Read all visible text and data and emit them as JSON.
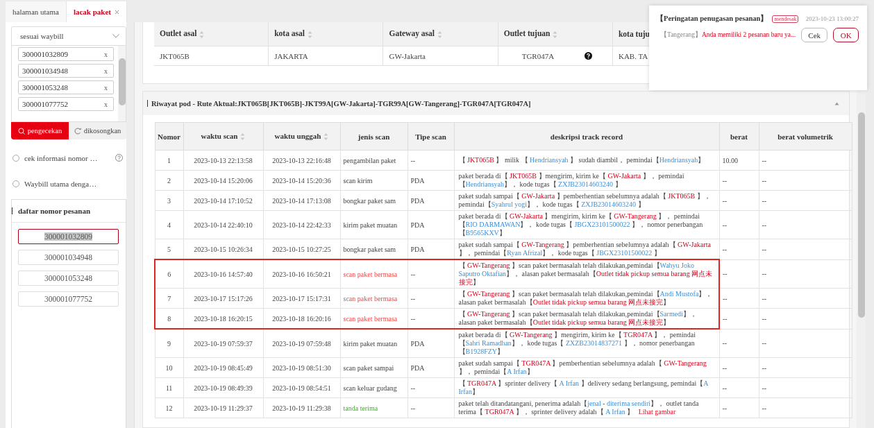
{
  "tabs": [
    {
      "label": "halaman utama",
      "selected": false,
      "closable": false
    },
    {
      "label": "lacak paket",
      "selected": true,
      "closable": true
    }
  ],
  "search_panel": {
    "mode_select": "sesuai waybill",
    "waybills": [
      {
        "number": "300001032809",
        "remove": "x"
      },
      {
        "number": "300001034948",
        "remove": "x"
      },
      {
        "number": "300001053248",
        "remove": "x"
      },
      {
        "number": "300001077752",
        "remove": "x"
      }
    ],
    "buttons": [
      {
        "label": "pengecekan",
        "kind": "primary"
      },
      {
        "label": "dikosongkan",
        "kind": "reset"
      }
    ],
    "options": [
      {
        "label": "cek informasi nomor …",
        "selected": false,
        "help": true
      },
      {
        "label": "Waybill utama denga…",
        "selected": false,
        "help": false
      }
    ]
  },
  "order_list": {
    "title": "daftar nomor pesanan",
    "items": [
      {
        "number": "300001032809",
        "selected": true
      },
      {
        "number": "300001034948",
        "selected": false
      },
      {
        "number": "300001053248",
        "selected": false
      },
      {
        "number": "300001077752",
        "selected": false
      }
    ]
  },
  "summary_table": {
    "columns": [
      {
        "label": "Outlet asal",
        "sortable": true
      },
      {
        "label": "kota asal",
        "sortable": true
      },
      {
        "label": "Gateway asal",
        "sortable": true
      },
      {
        "label": "Outlet tujuan",
        "sortable": true
      },
      {
        "label": "kota tuju",
        "sortable": false
      }
    ],
    "rows": [
      {
        "cells": [
          {
            "text": "JKT065B",
            "help": false
          },
          {
            "text": "JAKARTA",
            "help": false
          },
          {
            "text": "GW-Jakarta",
            "help": false
          },
          {
            "text": "TGR047A",
            "help": true
          },
          {
            "text": "KAB. TA",
            "help": false
          }
        ]
      }
    ]
  },
  "history": {
    "title": "Riwayat pod - Rute Aktual:JKT065B[JKT065B]-JKT99A[GW-Jakarta]-TGR99A[GW-Tangerang]-TGR047A[TGR047A]",
    "expanded": true,
    "columns": [
      {
        "label": "Nomor",
        "sortable": false
      },
      {
        "label": "waktu scan",
        "sortable": true
      },
      {
        "label": "waktu unggah",
        "sortable": true
      },
      {
        "label": "jenis scan",
        "sortable": false
      },
      {
        "label": "Tipe scan",
        "sortable": false
      },
      {
        "label": "deskripsi track record",
        "sortable": false
      },
      {
        "label": "berat",
        "sortable": false
      },
      {
        "label": "berat volumetrik",
        "sortable": false
      }
    ],
    "rows": [
      {
        "no": "1",
        "scan_time": "2023-10-13 22:13:58",
        "upload_time": "2023-10-13 22:16:48",
        "scan_type": "pengambilan paket",
        "problem": false,
        "signed": false,
        "device": "--",
        "flagged": false,
        "weight": "10.00",
        "volume": "--",
        "description": [
          {
            "kind": "plain",
            "text": "【 "
          },
          {
            "kind": "code",
            "text": "JKT065B"
          },
          {
            "kind": "plain",
            "text": " 】 milik 【 "
          },
          {
            "kind": "person",
            "text": "Hendriansyah"
          },
          {
            "kind": "plain",
            "text": " 】 sudah diambil， pemindai【"
          },
          {
            "kind": "person",
            "text": "Hendriansyah"
          },
          {
            "kind": "plain",
            "text": "】"
          }
        ]
      },
      {
        "no": "2",
        "scan_time": "2023-10-14 15:20:06",
        "upload_time": "2023-10-14 15:20:36",
        "scan_type": "scan kirim",
        "problem": false,
        "signed": false,
        "device": "PDA",
        "flagged": false,
        "weight": "--",
        "volume": "--",
        "description": [
          {
            "kind": "plain",
            "text": "paket berada di【 "
          },
          {
            "kind": "code",
            "text": "JKT065B"
          },
          {
            "kind": "plain",
            "text": " 】mengirim, kirim ke【 "
          },
          {
            "kind": "code",
            "text": "GW-Jakarta"
          },
          {
            "kind": "plain",
            "text": " 】， pemindai【"
          },
          {
            "kind": "person",
            "text": "Hendriansyah"
          },
          {
            "kind": "plain",
            "text": "】， kode tugas【 "
          },
          {
            "kind": "person",
            "text": "ZXJB23014603240"
          },
          {
            "kind": "plain",
            "text": " 】"
          }
        ]
      },
      {
        "no": "3",
        "scan_time": "2023-10-14 17:10:52",
        "upload_time": "2023-10-14 17:13:08",
        "scan_type": "bongkar paket sam",
        "problem": false,
        "signed": false,
        "device": "PDA",
        "flagged": false,
        "weight": "--",
        "volume": "--",
        "description": [
          {
            "kind": "plain",
            "text": "paket sudah sampai【 "
          },
          {
            "kind": "code",
            "text": "GW-Jakarta"
          },
          {
            "kind": "plain",
            "text": " 】pemberhentian sebelumnya adalah【 "
          },
          {
            "kind": "code",
            "text": "JKT065B"
          },
          {
            "kind": "plain",
            "text": " 】， pemindai【"
          },
          {
            "kind": "person",
            "text": "Syahrul yogi"
          },
          {
            "kind": "plain",
            "text": "】， kode tugas【 "
          },
          {
            "kind": "person",
            "text": "ZXJB23014603240"
          },
          {
            "kind": "plain",
            "text": " 】"
          }
        ]
      },
      {
        "no": "4",
        "scan_time": "2023-10-14 22:40:10",
        "upload_time": "2023-10-14 22:42:33",
        "scan_type": "kirim paket muatan",
        "problem": false,
        "signed": false,
        "device": "PDA",
        "flagged": false,
        "weight": "--",
        "volume": "--",
        "description": [
          {
            "kind": "plain",
            "text": "paket berada di【 "
          },
          {
            "kind": "code",
            "text": "GW-Jakarta"
          },
          {
            "kind": "plain",
            "text": " 】mengirim, kirim ke【 "
          },
          {
            "kind": "code",
            "text": "GW-Tangerang"
          },
          {
            "kind": "plain",
            "text": " 】， pemindai【"
          },
          {
            "kind": "person",
            "text": "RIO DARMAWAN"
          },
          {
            "kind": "plain",
            "text": "】， kode tugas【 "
          },
          {
            "kind": "person",
            "text": "JBGX23101500022"
          },
          {
            "kind": "plain",
            "text": " 】， nomor penerbangan【"
          },
          {
            "kind": "person",
            "text": "B9565KXV"
          },
          {
            "kind": "plain",
            "text": "】"
          }
        ]
      },
      {
        "no": "5",
        "scan_time": "2023-10-15 10:26:34",
        "upload_time": "2023-10-15 10:27:25",
        "scan_type": "bongkar paket sam",
        "problem": false,
        "signed": false,
        "device": "PDA",
        "flagged": false,
        "weight": "--",
        "volume": "--",
        "description": [
          {
            "kind": "plain",
            "text": "paket sudah sampai【 "
          },
          {
            "kind": "code",
            "text": "GW-Tangerang"
          },
          {
            "kind": "plain",
            "text": " 】pemberhentian sebelumnya adalah【 "
          },
          {
            "kind": "code",
            "text": "GW-Jakarta"
          },
          {
            "kind": "plain",
            "text": " 】， pemindai【"
          },
          {
            "kind": "person",
            "text": "Ryan Afrizal"
          },
          {
            "kind": "plain",
            "text": "】， kode tugas【 "
          },
          {
            "kind": "person",
            "text": "JBGX23101500022"
          },
          {
            "kind": "plain",
            "text": " 】"
          }
        ]
      },
      {
        "no": "6",
        "scan_time": "2023-10-16 14:57:40",
        "upload_time": "2023-10-16 16:50:21",
        "scan_type": "scan paket bermasa",
        "problem": true,
        "signed": false,
        "device": "--",
        "flagged": true,
        "weight": "--",
        "volume": "--",
        "description": [
          {
            "kind": "plain",
            "text": "【 "
          },
          {
            "kind": "code",
            "text": "GW-Tangerang"
          },
          {
            "kind": "plain",
            "text": " 】scan paket bermasalah telah dilakukan,pemindai【"
          },
          {
            "kind": "person",
            "text": "Wahyu Joko Saputro Oktafian"
          },
          {
            "kind": "plain",
            "text": "】， alasan paket bermasalah【"
          },
          {
            "kind": "code",
            "text": "Outlet tidak pickup semua barang 网点未接完"
          },
          {
            "kind": "plain",
            "text": "】"
          }
        ]
      },
      {
        "no": "7",
        "scan_time": "2023-10-17 15:17:26",
        "upload_time": "2023-10-17 15:17:31",
        "scan_type": "scan paket bermasa",
        "problem": true,
        "signed": false,
        "device": "--",
        "flagged": true,
        "weight": "--",
        "volume": "--",
        "description": [
          {
            "kind": "plain",
            "text": "【 "
          },
          {
            "kind": "code",
            "text": "GW-Tangerang"
          },
          {
            "kind": "plain",
            "text": " 】scan paket bermasalah telah dilakukan,pemindai【"
          },
          {
            "kind": "person",
            "text": "Andi Mustofa"
          },
          {
            "kind": "plain",
            "text": "】， alasan paket bermasalah【"
          },
          {
            "kind": "code",
            "text": "Outlet tidak pickup semua barang 网点未接完"
          },
          {
            "kind": "plain",
            "text": "】"
          }
        ]
      },
      {
        "no": "8",
        "scan_time": "2023-10-18 16:20:15",
        "upload_time": "2023-10-18 16:20:16",
        "scan_type": "scan paket bermasa",
        "problem": true,
        "signed": false,
        "device": "--",
        "flagged": true,
        "weight": "--",
        "volume": "--",
        "description": [
          {
            "kind": "plain",
            "text": "【 "
          },
          {
            "kind": "code",
            "text": "GW-Tangerang"
          },
          {
            "kind": "plain",
            "text": " 】scan paket bermasalah telah dilakukan,pemindai【"
          },
          {
            "kind": "person",
            "text": "Sarmedi"
          },
          {
            "kind": "plain",
            "text": "】， alasan paket bermasalah【"
          },
          {
            "kind": "code",
            "text": "Outlet tidak pickup semua barang 网点未接完"
          },
          {
            "kind": "plain",
            "text": "】"
          }
        ]
      },
      {
        "no": "9",
        "scan_time": "2023-10-19 07:59:37",
        "upload_time": "2023-10-19 07:59:48",
        "scan_type": "kirim paket muatan",
        "problem": false,
        "signed": false,
        "device": "PDA",
        "flagged": false,
        "weight": "--",
        "volume": "--",
        "description": [
          {
            "kind": "plain",
            "text": "paket berada di【 "
          },
          {
            "kind": "code",
            "text": "GW-Tangerang"
          },
          {
            "kind": "plain",
            "text": " 】mengirim, kirim ke【 "
          },
          {
            "kind": "code",
            "text": "TGR047A"
          },
          {
            "kind": "plain",
            "text": " 】， pemindai【"
          },
          {
            "kind": "person",
            "text": "Sahri Ramadhan"
          },
          {
            "kind": "plain",
            "text": "】， kode tugas【 "
          },
          {
            "kind": "person",
            "text": "ZXZB23014837271"
          },
          {
            "kind": "plain",
            "text": " 】， nomor penerbangan【"
          },
          {
            "kind": "person",
            "text": "B1928FZY"
          },
          {
            "kind": "plain",
            "text": "】"
          }
        ]
      },
      {
        "no": "10",
        "scan_time": "2023-10-19 08:45:49",
        "upload_time": "2023-10-19 08:51:30",
        "scan_type": "scan paket sampai",
        "problem": false,
        "signed": false,
        "device": "PDA",
        "flagged": false,
        "weight": "--",
        "volume": "--",
        "description": [
          {
            "kind": "plain",
            "text": "paket sudah sampai【 "
          },
          {
            "kind": "code",
            "text": "TGR047A"
          },
          {
            "kind": "plain",
            "text": " 】pemberhentian sebelumnya adalah【 "
          },
          {
            "kind": "code",
            "text": "GW-Tangerang"
          },
          {
            "kind": "plain",
            "text": " 】， pemindai【"
          },
          {
            "kind": "person",
            "text": "A Irfan"
          },
          {
            "kind": "plain",
            "text": "】"
          }
        ]
      },
      {
        "no": "11",
        "scan_time": "2023-10-19 08:49:39",
        "upload_time": "2023-10-19 08:54:51",
        "scan_type": "scan keluar gudang",
        "problem": false,
        "signed": false,
        "device": "--",
        "flagged": false,
        "weight": "--",
        "volume": "--",
        "description": [
          {
            "kind": "plain",
            "text": "【 "
          },
          {
            "kind": "code",
            "text": "TGR047A"
          },
          {
            "kind": "plain",
            "text": " 】sprinter delivery【 "
          },
          {
            "kind": "person",
            "text": "A Irfan"
          },
          {
            "kind": "plain",
            "text": " 】delivery sedang berlangsung, pemindai【"
          },
          {
            "kind": "person",
            "text": "A Irfan"
          },
          {
            "kind": "plain",
            "text": "】"
          }
        ]
      },
      {
        "no": "12",
        "scan_time": "2023-10-19 11:29:37",
        "upload_time": "2023-10-19 11:29:38",
        "scan_type": "tanda terima",
        "problem": false,
        "signed": true,
        "device": "--",
        "flagged": false,
        "weight": "--",
        "volume": "--",
        "description": [
          {
            "kind": "plain",
            "text": "paket telah ditandatangani, penerima adalah【"
          },
          {
            "kind": "person",
            "text": "jenal"
          },
          {
            "kind": "plain",
            "text": " - "
          },
          {
            "kind": "person",
            "text": "diterima sendiri"
          },
          {
            "kind": "plain",
            "text": "】， outlet tanda terima【 "
          },
          {
            "kind": "code",
            "text": "TGR047A"
          },
          {
            "kind": "plain",
            "text": " 】， sprinter delivery adalah【 "
          },
          {
            "kind": "person",
            "text": "A Irfan"
          },
          {
            "kind": "plain",
            "text": " 】 "
          },
          {
            "kind": "link",
            "text": "Lihat gambar"
          }
        ]
      }
    ]
  },
  "notification": {
    "title": "【Peringatan penugasan pesanan】",
    "badge": "mendesak",
    "time": "2023-10-23 13:00:27",
    "location": "【Tangerang】",
    "message": "Anda memiliki 2 pesanan baru ya...",
    "buttons": [
      {
        "label": "Cek",
        "kind": "secondary"
      },
      {
        "label": "OK",
        "kind": "primary"
      }
    ]
  }
}
